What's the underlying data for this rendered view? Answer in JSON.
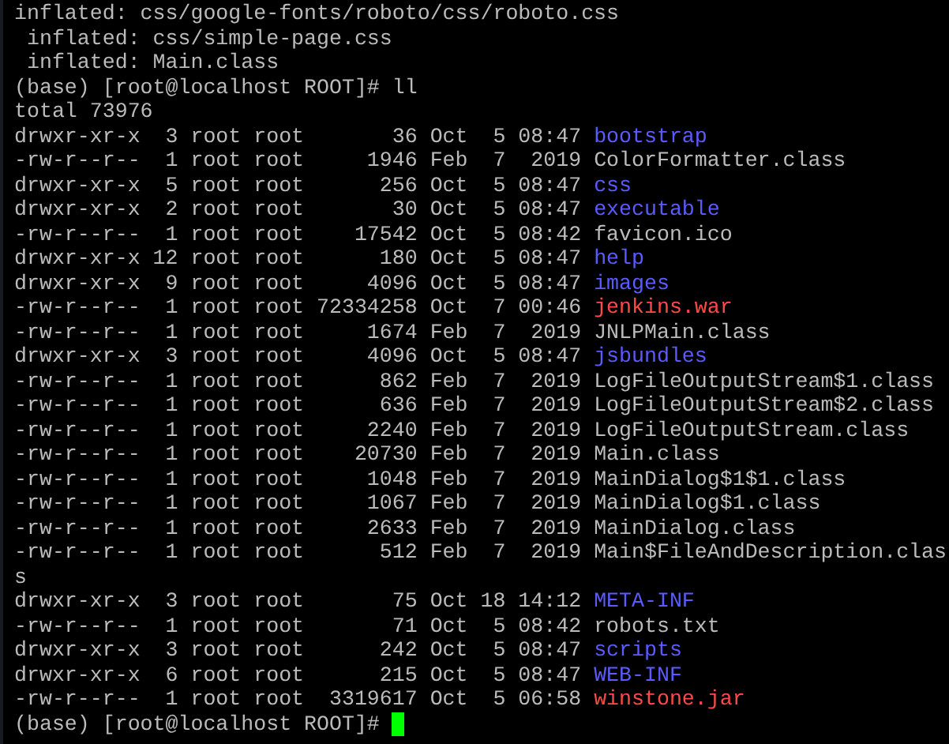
{
  "terminal": {
    "lines": [
      {
        "kind": "output",
        "text": "inflated: css/google-fonts/roboto/css/roboto.css"
      },
      {
        "kind": "output",
        "text": " inflated: css/simple-page.css"
      },
      {
        "kind": "output",
        "text": " inflated: Main.class"
      },
      {
        "kind": "prompt",
        "text": "(base) [root@localhost ROOT]# ll",
        "cursor": false
      },
      {
        "kind": "output",
        "text": "total 73976"
      },
      {
        "kind": "entry",
        "meta": "drwxr-xr-x  3 root root       36 Oct  5 08:47",
        "name": "bootstrap",
        "color": "#5b5bff"
      },
      {
        "kind": "entry",
        "meta": "-rw-r--r--  1 root root     1946 Feb  7  2019",
        "name": "ColorFormatter.class",
        "color": "#bbbbbb"
      },
      {
        "kind": "entry",
        "meta": "drwxr-xr-x  5 root root      256 Oct  5 08:47",
        "name": "css",
        "color": "#5b5bff"
      },
      {
        "kind": "entry",
        "meta": "drwxr-xr-x  2 root root       30 Oct  5 08:47",
        "name": "executable",
        "color": "#5b5bff"
      },
      {
        "kind": "entry",
        "meta": "-rw-r--r--  1 root root    17542 Oct  5 08:42",
        "name": "favicon.ico",
        "color": "#bbbbbb"
      },
      {
        "kind": "entry",
        "meta": "drwxr-xr-x 12 root root      180 Oct  5 08:47",
        "name": "help",
        "color": "#5b5bff"
      },
      {
        "kind": "entry",
        "meta": "drwxr-xr-x  9 root root     4096 Oct  5 08:47",
        "name": "images",
        "color": "#5b5bff"
      },
      {
        "kind": "entry",
        "meta": "-rw-r--r--  1 root root 72334258 Oct  7 00:46",
        "name": "jenkins.war",
        "color": "#ff4a4a"
      },
      {
        "kind": "entry",
        "meta": "-rw-r--r--  1 root root     1674 Feb  7  2019",
        "name": "JNLPMain.class",
        "color": "#bbbbbb"
      },
      {
        "kind": "entry",
        "meta": "drwxr-xr-x  3 root root     4096 Oct  5 08:47",
        "name": "jsbundles",
        "color": "#5b5bff"
      },
      {
        "kind": "entry",
        "meta": "-rw-r--r--  1 root root      862 Feb  7  2019",
        "name": "LogFileOutputStream$1.class",
        "color": "#bbbbbb"
      },
      {
        "kind": "entry",
        "meta": "-rw-r--r--  1 root root      636 Feb  7  2019",
        "name": "LogFileOutputStream$2.class",
        "color": "#bbbbbb"
      },
      {
        "kind": "entry",
        "meta": "-rw-r--r--  1 root root     2240 Feb  7  2019",
        "name": "LogFileOutputStream.class",
        "color": "#bbbbbb"
      },
      {
        "kind": "entry",
        "meta": "-rw-r--r--  1 root root    20730 Feb  7  2019",
        "name": "Main.class",
        "color": "#bbbbbb"
      },
      {
        "kind": "entry",
        "meta": "-rw-r--r--  1 root root     1048 Feb  7  2019",
        "name": "MainDialog$1$1.class",
        "color": "#bbbbbb"
      },
      {
        "kind": "entry",
        "meta": "-rw-r--r--  1 root root     1067 Feb  7  2019",
        "name": "MainDialog$1.class",
        "color": "#bbbbbb"
      },
      {
        "kind": "entry",
        "meta": "-rw-r--r--  1 root root     2633 Feb  7  2019",
        "name": "MainDialog.class",
        "color": "#bbbbbb"
      },
      {
        "kind": "entry",
        "meta": "-rw-r--r--  1 root root      512 Feb  7  2019",
        "name": "Main$FileAndDescription.clas",
        "color": "#bbbbbb"
      },
      {
        "kind": "output",
        "text": "s"
      },
      {
        "kind": "entry",
        "meta": "drwxr-xr-x  3 root root       75 Oct 18 14:12",
        "name": "META-INF",
        "color": "#5b5bff"
      },
      {
        "kind": "entry",
        "meta": "-rw-r--r--  1 root root       71 Oct  5 08:42",
        "name": "robots.txt",
        "color": "#bbbbbb"
      },
      {
        "kind": "entry",
        "meta": "drwxr-xr-x  3 root root      242 Oct  5 08:47",
        "name": "scripts",
        "color": "#5b5bff"
      },
      {
        "kind": "entry",
        "meta": "drwxr-xr-x  6 root root      215 Oct  5 08:47",
        "name": "WEB-INF",
        "color": "#5b5bff"
      },
      {
        "kind": "entry",
        "meta": "-rw-r--r--  1 root root  3319617 Oct  5 06:58",
        "name": "winstone.jar",
        "color": "#ff4a4a"
      },
      {
        "kind": "prompt",
        "text": "(base) [root@localhost ROOT]#",
        "cursor": true
      }
    ]
  }
}
